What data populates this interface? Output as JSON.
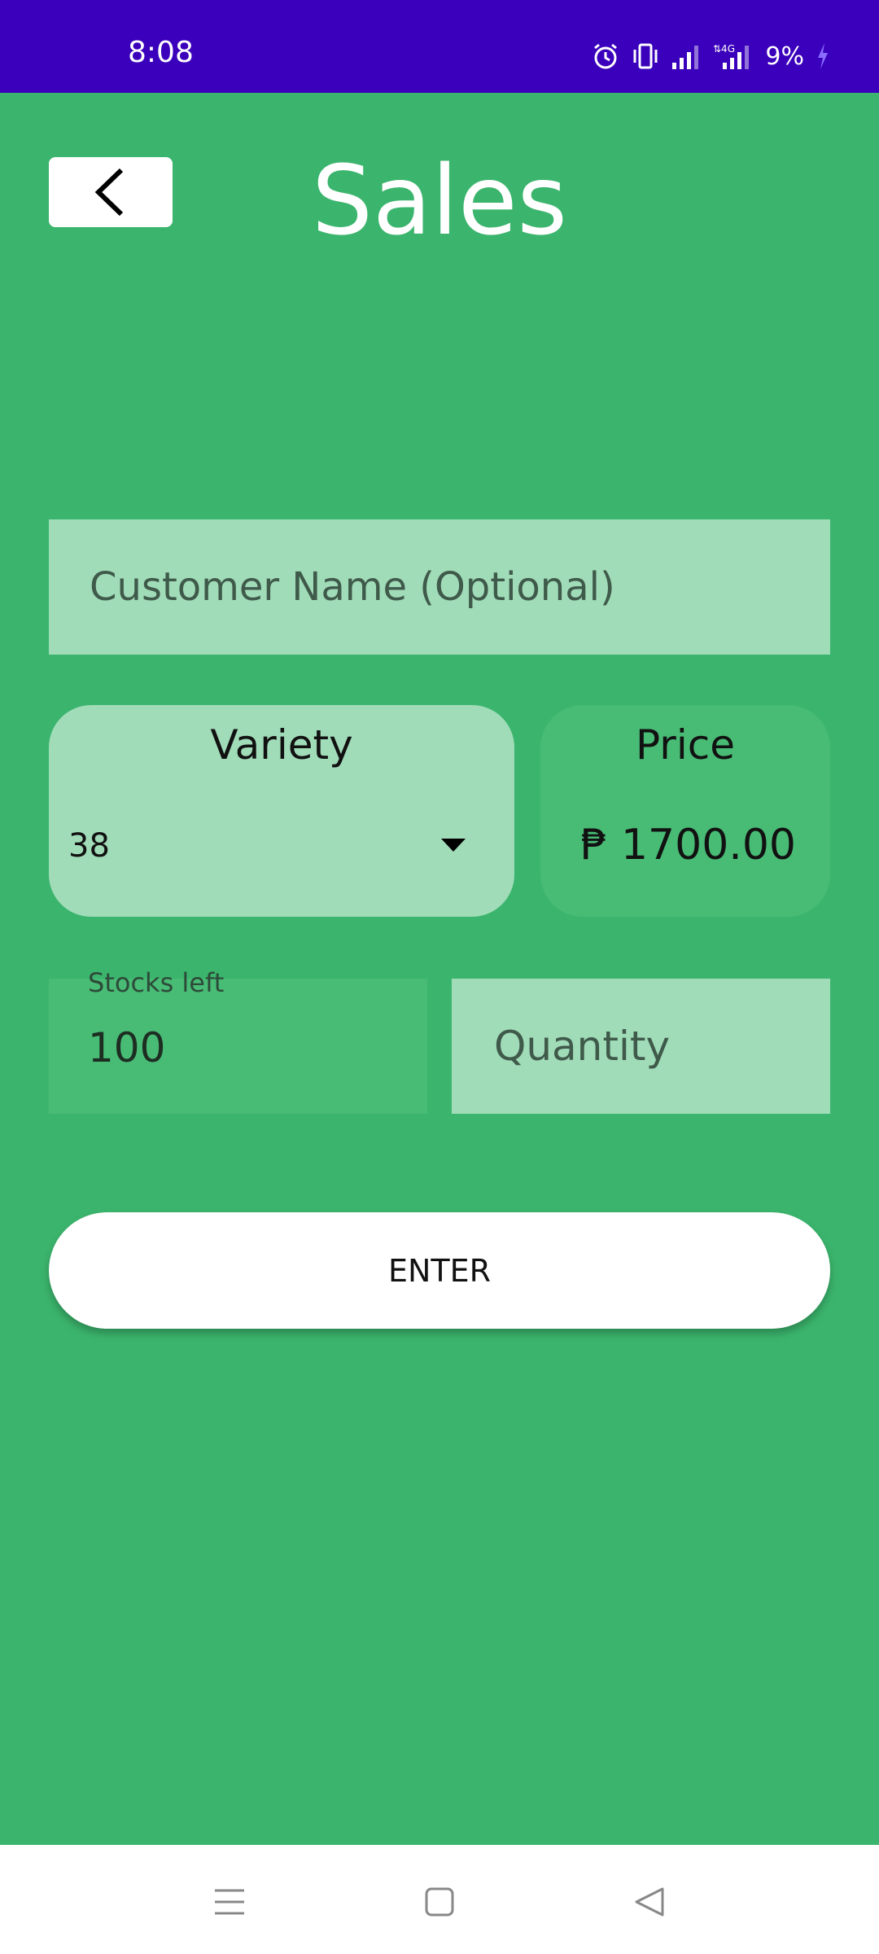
{
  "status_bar": {
    "time": "8:08",
    "battery": "9%",
    "icons": [
      "alarm-icon",
      "vibrate-icon",
      "signal-icon",
      "4g-signal-icon",
      "charging-icon"
    ],
    "background": "#3a00bb"
  },
  "header": {
    "title": "Sales",
    "back_icon": "chevron-left-icon"
  },
  "form": {
    "customer_name_placeholder": "Customer Name (Optional)",
    "customer_name_value": "",
    "variety": {
      "label": "Variety",
      "selected": "38"
    },
    "price": {
      "label": "Price",
      "value": "₱ 1700.00"
    },
    "stocks": {
      "label": "Stocks left",
      "value": "100"
    },
    "quantity_placeholder": "Quantity",
    "enter_label": "ENTER"
  },
  "nav": {
    "items": [
      "menu-icon",
      "home-icon",
      "back-icon"
    ]
  },
  "colors": {
    "background": "#3bb56d",
    "field_light": "#a1dcb9",
    "field_mid": "#48bb75"
  }
}
